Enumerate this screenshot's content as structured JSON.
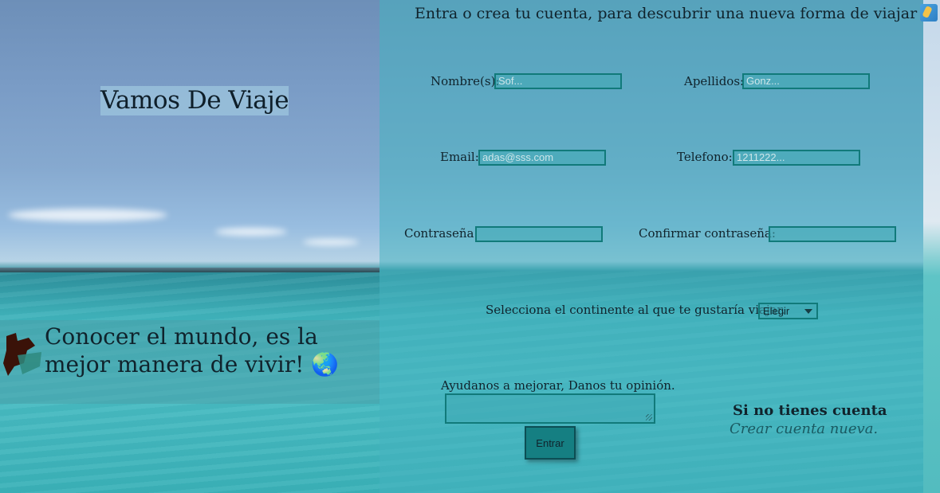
{
  "brand": {
    "name": "Vamos De Viaje"
  },
  "slogan": {
    "text": "Conocer el mundo, es la mejor manera de vivir!",
    "emoji": "🌏"
  },
  "form": {
    "title": "Entra o crea tu cuenta, para descubrir una nueva forma de viajar",
    "title_icon": "surfer-icon",
    "fields": {
      "nombre": {
        "label": "Nombre(s):",
        "placeholder": "Sof...",
        "value": ""
      },
      "apellidos": {
        "label": "Apellidos:",
        "placeholder": "Gonz...",
        "value": ""
      },
      "email": {
        "label": "Email:",
        "placeholder": "adas@sss.com",
        "value": ""
      },
      "telefono": {
        "label": "Telefono:",
        "placeholder": "1211222...",
        "value": ""
      },
      "password": {
        "label": "Contraseña:",
        "placeholder": "",
        "value": ""
      },
      "confirm": {
        "label": "Confirmar contraseña:",
        "placeholder": "",
        "value": ""
      }
    },
    "continent": {
      "label": "Selecciona el continente al que te gustaría viajar.",
      "selected": "Elegir"
    },
    "feedback": {
      "label": "Ayudanos a mejorar, Danos tu opinión."
    },
    "submit_label": "Entrar"
  },
  "signup": {
    "prompt": "Si no tienes cuenta",
    "link": "Crear cuenta nueva."
  },
  "colors": {
    "panel": "#45b2c0",
    "input_border": "#117a7a",
    "button": "#157f82",
    "text": "#10232c"
  }
}
